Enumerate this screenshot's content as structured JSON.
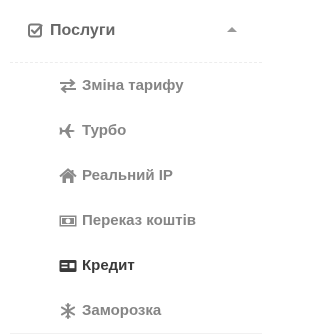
{
  "section": {
    "title": "Послуги",
    "expanded": true,
    "icon": "check-square-icon"
  },
  "colors": {
    "header_text": "#666666",
    "item_text": "#858585",
    "active_item_text": "#3a3a3a"
  },
  "items": [
    {
      "label": "Зміна тарифу",
      "icon": "exchange-icon",
      "active": false
    },
    {
      "label": "Турбо",
      "icon": "plane-icon",
      "active": false
    },
    {
      "label": "Реальний IP",
      "icon": "home-icon",
      "active": false
    },
    {
      "label": "Переказ коштів",
      "icon": "money-icon",
      "active": false
    },
    {
      "label": "Кредит",
      "icon": "credit-card-icon",
      "active": true
    },
    {
      "label": "Заморозка",
      "icon": "snowflake-icon",
      "active": false
    }
  ]
}
